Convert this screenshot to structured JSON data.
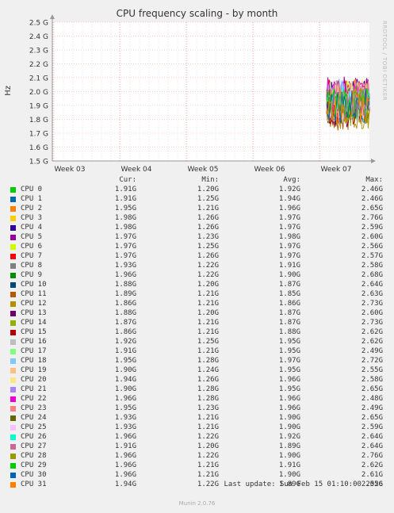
{
  "title": "CPU frequency scaling - by month",
  "side_text": "RRDTOOL / TOBI OETIKER",
  "legend_headers": {
    "cur": "Cur:",
    "min": "Min:",
    "avg": "Avg:",
    "max": "Max:"
  },
  "last_update": "Last update: Sun Feb 15 01:10:00 2026",
  "footer": "Munin 2.0.76",
  "chart_data": {
    "type": "line",
    "ylabel": "Hz",
    "y_ticks": [
      "1.5 G",
      "1.6 G",
      "1.7 G",
      "1.8 G",
      "1.9 G",
      "2.0 G",
      "2.1 G",
      "2.2 G",
      "2.3 G",
      "2.4 G",
      "2.5 G"
    ],
    "ylim": [
      1.5,
      2.5
    ],
    "y_unit": "GHz",
    "x_ticks": [
      "Week 03",
      "Week 04",
      "Week 05",
      "Week 06",
      "Week 07"
    ],
    "grid": true,
    "data_range_note": "data present only from late Week 07 onward",
    "series": [
      {
        "name": "CPU 0",
        "color": "#00cc00",
        "cur": "1.91G",
        "min": "1.20G",
        "avg": "1.92G",
        "max": "2.46G"
      },
      {
        "name": "CPU 1",
        "color": "#0066b3",
        "cur": "1.91G",
        "min": "1.25G",
        "avg": "1.94G",
        "max": "2.46G"
      },
      {
        "name": "CPU 2",
        "color": "#ff8000",
        "cur": "1.95G",
        "min": "1.21G",
        "avg": "1.96G",
        "max": "2.65G"
      },
      {
        "name": "CPU 3",
        "color": "#ffcc00",
        "cur": "1.98G",
        "min": "1.26G",
        "avg": "1.97G",
        "max": "2.76G"
      },
      {
        "name": "CPU 4",
        "color": "#330099",
        "cur": "1.98G",
        "min": "1.26G",
        "avg": "1.97G",
        "max": "2.59G"
      },
      {
        "name": "CPU 5",
        "color": "#990099",
        "cur": "1.97G",
        "min": "1.23G",
        "avg": "1.98G",
        "max": "2.60G"
      },
      {
        "name": "CPU 6",
        "color": "#ccff00",
        "cur": "1.97G",
        "min": "1.25G",
        "avg": "1.97G",
        "max": "2.56G"
      },
      {
        "name": "CPU 7",
        "color": "#ff0000",
        "cur": "1.97G",
        "min": "1.26G",
        "avg": "1.97G",
        "max": "2.57G"
      },
      {
        "name": "CPU 8",
        "color": "#808080",
        "cur": "1.93G",
        "min": "1.22G",
        "avg": "1.91G",
        "max": "2.58G"
      },
      {
        "name": "CPU 9",
        "color": "#008f00",
        "cur": "1.96G",
        "min": "1.22G",
        "avg": "1.90G",
        "max": "2.68G"
      },
      {
        "name": "CPU 10",
        "color": "#00487d",
        "cur": "1.88G",
        "min": "1.20G",
        "avg": "1.87G",
        "max": "2.64G"
      },
      {
        "name": "CPU 11",
        "color": "#b35a00",
        "cur": "1.89G",
        "min": "1.21G",
        "avg": "1.85G",
        "max": "2.63G"
      },
      {
        "name": "CPU 12",
        "color": "#b38f00",
        "cur": "1.86G",
        "min": "1.21G",
        "avg": "1.86G",
        "max": "2.73G"
      },
      {
        "name": "CPU 13",
        "color": "#6b006b",
        "cur": "1.88G",
        "min": "1.20G",
        "avg": "1.87G",
        "max": "2.60G"
      },
      {
        "name": "CPU 14",
        "color": "#8fb300",
        "cur": "1.87G",
        "min": "1.21G",
        "avg": "1.87G",
        "max": "2.73G"
      },
      {
        "name": "CPU 15",
        "color": "#b30000",
        "cur": "1.86G",
        "min": "1.21G",
        "avg": "1.88G",
        "max": "2.62G"
      },
      {
        "name": "CPU 16",
        "color": "#bebebe",
        "cur": "1.92G",
        "min": "1.25G",
        "avg": "1.95G",
        "max": "2.62G"
      },
      {
        "name": "CPU 17",
        "color": "#80ff80",
        "cur": "1.91G",
        "min": "1.21G",
        "avg": "1.95G",
        "max": "2.49G"
      },
      {
        "name": "CPU 18",
        "color": "#80c9ff",
        "cur": "1.95G",
        "min": "1.28G",
        "avg": "1.97G",
        "max": "2.72G"
      },
      {
        "name": "CPU 19",
        "color": "#ffc080",
        "cur": "1.90G",
        "min": "1.24G",
        "avg": "1.95G",
        "max": "2.55G"
      },
      {
        "name": "CPU 20",
        "color": "#ffe680",
        "cur": "1.94G",
        "min": "1.26G",
        "avg": "1.96G",
        "max": "2.58G"
      },
      {
        "name": "CPU 21",
        "color": "#aa80ff",
        "cur": "1.90G",
        "min": "1.28G",
        "avg": "1.95G",
        "max": "2.65G"
      },
      {
        "name": "CPU 22",
        "color": "#ee00cc",
        "cur": "1.96G",
        "min": "1.28G",
        "avg": "1.96G",
        "max": "2.48G"
      },
      {
        "name": "CPU 23",
        "color": "#ff8080",
        "cur": "1.95G",
        "min": "1.23G",
        "avg": "1.96G",
        "max": "2.49G"
      },
      {
        "name": "CPU 24",
        "color": "#666600",
        "cur": "1.93G",
        "min": "1.21G",
        "avg": "1.90G",
        "max": "2.65G"
      },
      {
        "name": "CPU 25",
        "color": "#ffbfff",
        "cur": "1.93G",
        "min": "1.21G",
        "avg": "1.90G",
        "max": "2.59G"
      },
      {
        "name": "CPU 26",
        "color": "#00ffcc",
        "cur": "1.96G",
        "min": "1.22G",
        "avg": "1.92G",
        "max": "2.64G"
      },
      {
        "name": "CPU 27",
        "color": "#cc6699",
        "cur": "1.91G",
        "min": "1.20G",
        "avg": "1.89G",
        "max": "2.64G"
      },
      {
        "name": "CPU 28",
        "color": "#999900",
        "cur": "1.96G",
        "min": "1.22G",
        "avg": "1.90G",
        "max": "2.76G"
      },
      {
        "name": "CPU 29",
        "color": "#00cc00",
        "cur": "1.96G",
        "min": "1.21G",
        "avg": "1.91G",
        "max": "2.62G"
      },
      {
        "name": "CPU 30",
        "color": "#0066b3",
        "cur": "1.96G",
        "min": "1.21G",
        "avg": "1.90G",
        "max": "2.61G"
      },
      {
        "name": "CPU 31",
        "color": "#ff8000",
        "cur": "1.94G",
        "min": "1.22G",
        "avg": "1.89G",
        "max": "2.55G"
      }
    ]
  }
}
